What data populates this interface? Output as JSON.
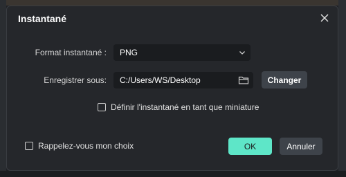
{
  "dialog": {
    "title": "Instantané",
    "format_label": "Format instantané :",
    "format_value": "PNG",
    "save_label": "Enregistrer sous:",
    "save_path": "C:/Users/WS/Desktop",
    "change_button": "Changer",
    "thumbnail_checkbox": {
      "label": "Définir l'instantané en tant que miniature",
      "checked": false
    },
    "remember_checkbox": {
      "label": "Rappelez-vous mon choix",
      "checked": false
    },
    "ok_button": "OK",
    "cancel_button": "Annuler"
  },
  "colors": {
    "accent": "#5ee6c8",
    "dialog_bg": "#25272b",
    "field_bg": "#1a1c1f",
    "secondary_button": "#3e434a"
  }
}
